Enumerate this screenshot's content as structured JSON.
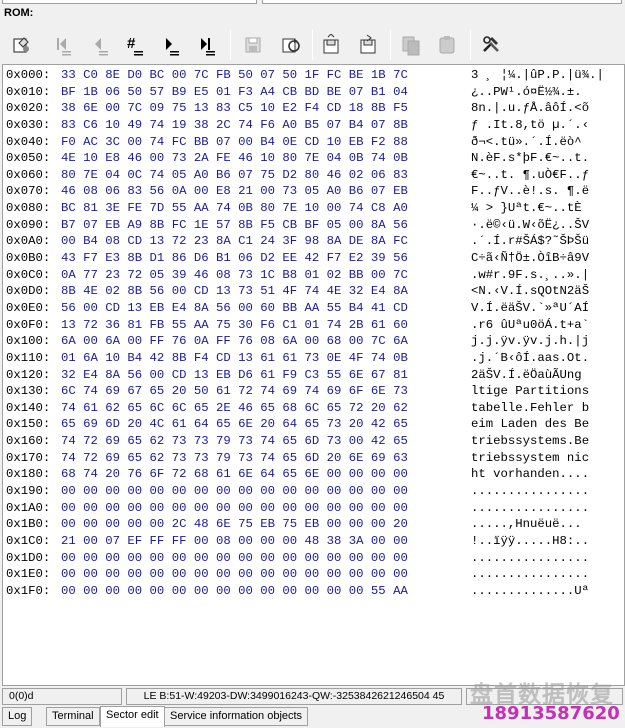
{
  "title": "ROM:",
  "toolbar": {
    "buttons": [
      {
        "name": "open-icon"
      },
      {
        "name": "first-sector-icon"
      },
      {
        "name": "prev-sector-icon"
      },
      {
        "name": "goto-sector-icon"
      },
      {
        "name": "next-sector-icon"
      },
      {
        "name": "last-sector-icon"
      },
      {
        "name": "save-sector-icon"
      },
      {
        "name": "refresh-icon"
      },
      {
        "name": "read-sector-icon"
      },
      {
        "name": "write-sector-icon"
      },
      {
        "name": "copy-icon"
      },
      {
        "name": "paste-icon"
      },
      {
        "name": "tools-icon"
      }
    ]
  },
  "hex": {
    "rows": [
      {
        "addr": "0x000:",
        "bytes": "33 C0 8E D0 BC 00 7C FB 50 07 50 1F FC BE 1B 7C",
        "ascii": "3 ¸ ¦¼.|ûP.P.|ü¾.|"
      },
      {
        "addr": "0x010:",
        "bytes": "BF 1B 06 50 57 B9 E5 01 F3 A4 CB BD BE 07 B1 04",
        "ascii": "¿..PW¹.ó¤Ë½¾.±."
      },
      {
        "addr": "0x020:",
        "bytes": "38 6E 00 7C 09 75 13 83 C5 10 E2 F4 CD 18 8B F5",
        "ascii": "8n.|.u.ƒÅ.âôÍ.<õ"
      },
      {
        "addr": "0x030:",
        "bytes": "83 C6 10 49 74 19 38 2C 74 F6 A0 B5 07 B4 07 8B",
        "ascii": "ƒ .It.8,tö µ.´.‹"
      },
      {
        "addr": "0x040:",
        "bytes": "F0 AC 3C 00 74 FC BB 07 00 B4 0E CD 10 EB F2 88",
        "ascii": "ð¬<.tü».´.Í.ëò^"
      },
      {
        "addr": "0x050:",
        "bytes": "4E 10 E8 46 00 73 2A FE 46 10 80 7E 04 0B 74 0B",
        "ascii": "N.èF.s*þF.€~..t."
      },
      {
        "addr": "0x060:",
        "bytes": "80 7E 04 0C 74 05 A0 B6 07 75 D2 80 46 02 06 83",
        "ascii": "€~..t. ¶.uÒ€F..ƒ"
      },
      {
        "addr": "0x070:",
        "bytes": "46 08 06 83 56 0A 00 E8 21 00 73 05 A0 B6 07 EB",
        "ascii": "F..ƒV..è!.s. ¶.ë"
      },
      {
        "addr": "0x080:",
        "bytes": "BC 81 3E FE 7D 55 AA 74 0B 80 7E 10 00 74 C8 A0",
        "ascii": "¼ > }Uªt.€~..tÈ "
      },
      {
        "addr": "0x090:",
        "bytes": "B7 07 EB A9 8B FC 1E 57 8B F5 CB BF 05 00 8A 56",
        "ascii": "·.ë©‹ü.W‹õË¿..ŠV"
      },
      {
        "addr": "0x0A0:",
        "bytes": "00 B4 08 CD 13 72 23 8A C1 24 3F 98 8A DE 8A FC",
        "ascii": ".´.Í.r#ŠÁ$?˜ŠÞŠü"
      },
      {
        "addr": "0x0B0:",
        "bytes": "43 F7 E3 8B D1 86 D6 B1 06 D2 EE 42 F7 E2 39 56",
        "ascii": "C÷ã‹Ñ†Ö±.ÒîB÷â9V"
      },
      {
        "addr": "0x0C0:",
        "bytes": "0A 77 23 72 05 39 46 08 73 1C B8 01 02 BB 00 7C",
        "ascii": ".w#r.9F.s.¸..».|"
      },
      {
        "addr": "0x0D0:",
        "bytes": "8B 4E 02 8B 56 00 CD 13 73 51 4F 74 4E 32 E4 8A",
        "ascii": "<N.‹V.Í.sQOtN2äŠ"
      },
      {
        "addr": "0x0E0:",
        "bytes": "56 00 CD 13 EB E4 8A 56 00 60 BB AA 55 B4 41 CD",
        "ascii": "V.Í.ëäŠV.`»ªU´AÍ"
      },
      {
        "addr": "0x0F0:",
        "bytes": "13 72 36 81 FB 55 AA 75 30 F6 C1 01 74 2B 61 60",
        "ascii": ".r6 ûUªu0öÁ.t+a`"
      },
      {
        "addr": "0x100:",
        "bytes": "6A 00 6A 00 FF 76 0A FF 76 08 6A 00 68 00 7C 6A",
        "ascii": "j.j.ÿv.ÿv.j.h.|j"
      },
      {
        "addr": "0x110:",
        "bytes": "01 6A 10 B4 42 8B F4 CD 13 61 61 73 0E 4F 74 0B",
        "ascii": ".j.´B‹ôÍ.aas.Ot."
      },
      {
        "addr": "0x120:",
        "bytes": "32 E4 8A 56 00 CD 13 EB D6 61 F9 C3 55 6E 67 81",
        "ascii": "2äŠV.Í.ëÖaùÃUng"
      },
      {
        "addr": "0x130:",
        "bytes": "6C 74 69 67 65 20 50 61 72 74 69 74 69 6F 6E 73",
        "ascii": "ltige Partitions"
      },
      {
        "addr": "0x140:",
        "bytes": "74 61 62 65 6C 6C 65 2E 46 65 68 6C 65 72 20 62",
        "ascii": "tabelle.Fehler b"
      },
      {
        "addr": "0x150:",
        "bytes": "65 69 6D 20 4C 61 64 65 6E 20 64 65 73 20 42 65",
        "ascii": "eim Laden des Be"
      },
      {
        "addr": "0x160:",
        "bytes": "74 72 69 65 62 73 73 79 73 74 65 6D 73 00 42 65",
        "ascii": "triebssystems.Be"
      },
      {
        "addr": "0x170:",
        "bytes": "74 72 69 65 62 73 73 79 73 74 65 6D 20 6E 69 63",
        "ascii": "triebssystem nic"
      },
      {
        "addr": "0x180:",
        "bytes": "68 74 20 76 6F 72 68 61 6E 64 65 6E 00 00 00 00",
        "ascii": "ht vorhanden...."
      },
      {
        "addr": "0x190:",
        "bytes": "00 00 00 00 00 00 00 00 00 00 00 00 00 00 00 00",
        "ascii": "................"
      },
      {
        "addr": "0x1A0:",
        "bytes": "00 00 00 00 00 00 00 00 00 00 00 00 00 00 00 00",
        "ascii": "................"
      },
      {
        "addr": "0x1B0:",
        "bytes": "00 00 00 00 00 2C 48 6E 75 EB 75 EB 00 00 00 20",
        "ascii": ".....,Hnuëuë... "
      },
      {
        "addr": "0x1C0:",
        "bytes": "21 00 07 EF FF FF 00 08 00 00 00 48 38 3A 00 00",
        "ascii": "!..ïÿÿ.....H8:.."
      },
      {
        "addr": "0x1D0:",
        "bytes": "00 00 00 00 00 00 00 00 00 00 00 00 00 00 00 00",
        "ascii": "................"
      },
      {
        "addr": "0x1E0:",
        "bytes": "00 00 00 00 00 00 00 00 00 00 00 00 00 00 00 00",
        "ascii": "................"
      },
      {
        "addr": "0x1F0:",
        "bytes": "00 00 00 00 00 00 00 00 00 00 00 00 00 00 55 AA",
        "ascii": "..............Uª"
      }
    ]
  },
  "status": {
    "offset": "0(0)d",
    "values": "LE B:51-W:49203-DW:3499016243-QW:-3253842621246504 45"
  },
  "tabs": [
    {
      "label": "Log"
    },
    {
      "label": "Terminal"
    },
    {
      "label": "Sector edit"
    },
    {
      "label": "Service information objects"
    }
  ],
  "watermark": {
    "text": "盘首数据恢复",
    "phone": "18913587620"
  }
}
